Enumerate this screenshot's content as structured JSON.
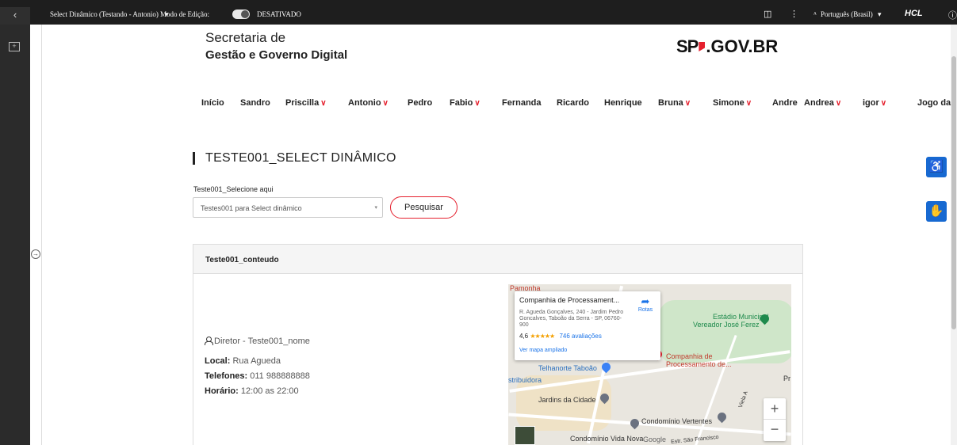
{
  "topbar": {
    "back_icon": "chevron-left",
    "page_selector": "Select Dinâmico (Testando - Antonio)",
    "page_selector_caret": "▾",
    "edit_mode_label": "Modo de Edição:",
    "edit_mode_state": "DESATIVADO",
    "layout_icon": "◫",
    "more_icon": "⋮",
    "language": "Português (Brasil)",
    "language_icon": "ᴬ",
    "language_caret": "▾",
    "brand": "HCL",
    "info_icon": "ⓘ"
  },
  "sidebar": {
    "panel_icon": "+",
    "expand_icon": "→"
  },
  "header": {
    "org_line1": "Secretaria de",
    "org_line2": "Gestão e Governo Digital",
    "gov_logo_sp": "SP",
    "gov_logo_rest": ".GOV.BR"
  },
  "nav": {
    "items": [
      {
        "label": "Início"
      },
      {
        "label": "Sandro"
      },
      {
        "label": "Priscilla",
        "caret": "∨"
      },
      {
        "label": "Antonio",
        "caret": "∨"
      },
      {
        "label": "Pedro"
      },
      {
        "label": "Fabio",
        "caret": "∨"
      },
      {
        "label": "Fernanda"
      },
      {
        "label": "Ricardo"
      },
      {
        "label": "Henrique"
      },
      {
        "label": "Bruna",
        "caret": "∨"
      },
      {
        "label": "Simone",
        "caret": "∨"
      },
      {
        "label": "Andre"
      },
      {
        "label": "Andrea",
        "caret": "∨"
      },
      {
        "label": "igor",
        "caret": "∨"
      },
      {
        "label": "Jogo da"
      }
    ]
  },
  "main": {
    "title": "TESTE001_SELECT DINÂMICO",
    "select_label": "Teste001_Selecione aqui",
    "select_value": "Testes001 para Select dinâmico",
    "select_caret": "▾",
    "search_button": "Pesquisar"
  },
  "panel": {
    "header": "Teste001_conteudo",
    "director": "Diretor - Teste001_nome",
    "local_label": "Local:",
    "local_value": " Rua Agueda",
    "phone_label": "Telefones:",
    "phone_value": " 011 988888888",
    "hours_label": "Horário:",
    "hours_value": " 12:00 as 22:00"
  },
  "map": {
    "popup_title": "Companhia de Processament...",
    "popup_address": "R. Agueda Gonçalves, 240 - Jardim Pedro Goncalves, Taboão da Serra - SP, 06760-900",
    "popup_rating": "4,6",
    "popup_stars": "★★★★★",
    "popup_reviews": "746 avaliações",
    "popup_link": "Ver mapa ampliado",
    "popup_directions": "Rotas",
    "labels": {
      "pamonha": "Pamonha",
      "estadio": "Estádio Municipal",
      "estadio2": "Vereador José Ferez",
      "companhia": "Companhia de",
      "companhia2": "Processamento de...",
      "telhanorte": "Telhanorte Taboão",
      "distribuidora": "stribuidora",
      "jardins": "Jardins da Cidade",
      "vertentes": "Condomínio Vertentes",
      "vida_nova": "Condomínio Vida Nova",
      "google": "Google",
      "sao_francisco": "Estr. São Francisco",
      "viela": "Viela A",
      "pr": "Pr"
    },
    "zoom_in": "+",
    "zoom_out": "−"
  },
  "floating": {
    "accessibility_icon": "♿",
    "sign_language_icon": "✋"
  },
  "colors": {
    "accent": "#e5202e",
    "float_blue": "#1769d1",
    "topbar": "#1e1e1e"
  }
}
